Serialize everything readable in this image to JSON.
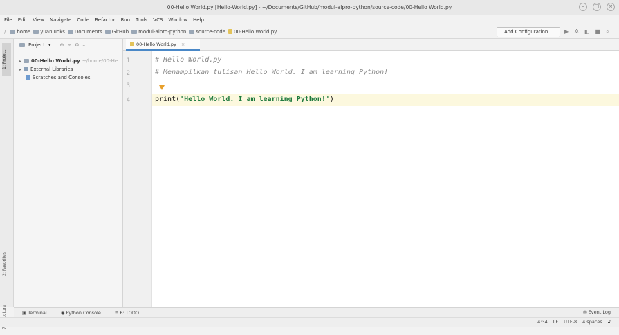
{
  "window": {
    "title": "00-Hello World.py [Hello-World.py] - ~/Documents/GitHub/modul-alpro-python/source-code/00-Hello World.py"
  },
  "menubar": {
    "items": [
      "File",
      "Edit",
      "View",
      "Navigate",
      "Code",
      "Refactor",
      "Run",
      "Tools",
      "VCS",
      "Window",
      "Help"
    ]
  },
  "navbar": {
    "breadcrumbs": [
      "home",
      "yuanluoks",
      "Documents",
      "GitHub",
      "modul-alpro-python",
      "source-code",
      "00-Hello World.py"
    ],
    "add_config": "Add Configuration..."
  },
  "left_strip": {
    "project_tab": "1: Project",
    "favorites_tab": "2: Favorites",
    "structure_tab": "7: Structure"
  },
  "project_panel": {
    "header": "Project",
    "items": [
      {
        "label": "00-Hello World.py",
        "hint": "~/home/00-He"
      },
      {
        "label": "External Libraries"
      },
      {
        "label": "Scratches and Consoles"
      }
    ]
  },
  "editor": {
    "tab_label": "00-Hello World.py",
    "line_numbers": [
      "1",
      "2",
      "3",
      "4"
    ],
    "line1": "# Hello World.py",
    "line2": "# Menampilkan tulisan Hello World. I am learning Python!",
    "line4_fn": "print(",
    "line4_str": "'Hello World. I am learning Python!'",
    "line4_close": ")"
  },
  "toolwindows": {
    "terminal": "Terminal",
    "python_console": "Python Console",
    "todo": "6: TODO",
    "event_log": "Event Log"
  },
  "statusbar": {
    "position": "4:34",
    "line_sep": "LF",
    "encoding": "UTF-8",
    "indent": "4 spaces"
  }
}
